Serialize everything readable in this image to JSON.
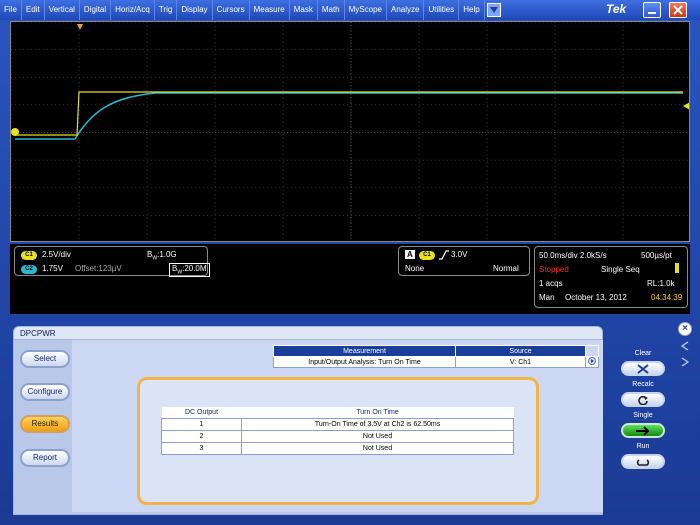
{
  "menu": {
    "items": [
      "File",
      "Edit",
      "Vertical",
      "Digital",
      "Horiz/Acq",
      "Trig",
      "Display",
      "Cursors",
      "Measure",
      "Mask",
      "Math",
      "MyScope",
      "Analyze",
      "Utilities",
      "Help"
    ]
  },
  "brand": "Tek",
  "ch1": {
    "badge": "C1",
    "scale": "2.5V/div",
    "bw": "1.0G"
  },
  "ch2": {
    "badge": "C2",
    "scale": "1.75V",
    "offset": "Offset:123µV",
    "bw": "20.0M"
  },
  "trigger": {
    "source_box": "A",
    "badge": "C1",
    "level": "3.0V",
    "coupling": "None",
    "mode": "Normal"
  },
  "horizontal": {
    "timebase": "50.0ms/div 2.0kS/s",
    "resolution": "500µs/pt",
    "state": "Stopped",
    "seq": "Single Seq",
    "acqs": "1 acqs",
    "record_length": "RL:1.0k",
    "mode": "Man",
    "date": "October 13, 2012",
    "time": "04:34:39"
  },
  "app": {
    "title": "DPCPWR",
    "nav": [
      "Select",
      "Configure",
      "Results",
      "Report"
    ],
    "measurement_table": {
      "headers": [
        "Measurement",
        "Source"
      ],
      "row": [
        "Input/Output Analysis: Turn On Time",
        "V: Ch1"
      ]
    },
    "results_table": {
      "headers": [
        "DC Output",
        "Turn On Time"
      ],
      "rows": [
        [
          "1",
          "Turn-On Time of 3.5V at Ch2 is 62.50ms"
        ],
        [
          "2",
          "Not Used"
        ],
        [
          "3",
          "Not Used"
        ]
      ]
    },
    "right_buttons": {
      "clear": "Clear",
      "recalc": "Recalc",
      "single": "Single",
      "run": "Run"
    }
  },
  "colors": {
    "ch1": "#e8e020",
    "ch2": "#26b8cf",
    "accent": "#f0b448"
  }
}
